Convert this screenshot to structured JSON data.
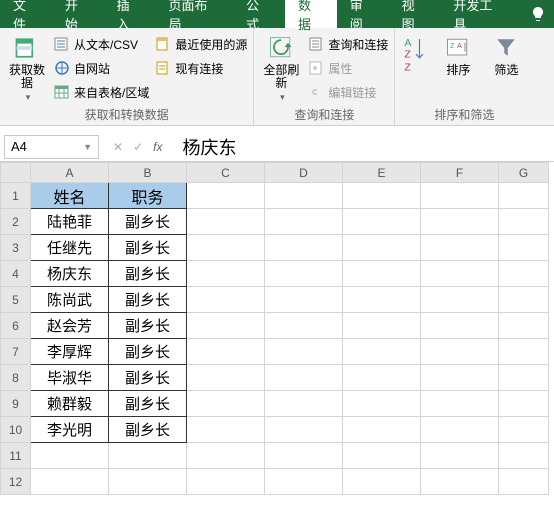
{
  "tabs": [
    "文件",
    "开始",
    "插入",
    "页面布局",
    "公式",
    "数据",
    "审阅",
    "视图",
    "开发工具"
  ],
  "ribbon": {
    "g1": {
      "big": "获取数\n据",
      "items": [
        "从文本/CSV",
        "最近使用的源",
        "自网站",
        "现有连接",
        "来自表格/区域"
      ],
      "label": "获取和转换数据"
    },
    "g2": {
      "big": "全部刷新",
      "items": [
        "查询和连接",
        "属性",
        "编辑链接"
      ],
      "label": "查询和连接"
    },
    "g3": {
      "items": [
        "排序",
        "筛选"
      ],
      "label": "排序和筛选"
    }
  },
  "namebox": "A4",
  "fx_value": "杨庆东",
  "cols": [
    "A",
    "B",
    "C",
    "D",
    "E",
    "F",
    "G"
  ],
  "headers": [
    "姓名",
    "职务"
  ],
  "rows": [
    [
      "陆艳菲",
      "副乡长"
    ],
    [
      "任继先",
      "副乡长"
    ],
    [
      "杨庆东",
      "副乡长"
    ],
    [
      "陈尚武",
      "副乡长"
    ],
    [
      "赵会芳",
      "副乡长"
    ],
    [
      "李厚辉",
      "副乡长"
    ],
    [
      "毕淑华",
      "副乡长"
    ],
    [
      "赖群毅",
      "副乡长"
    ],
    [
      "李光明",
      "副乡长"
    ]
  ]
}
